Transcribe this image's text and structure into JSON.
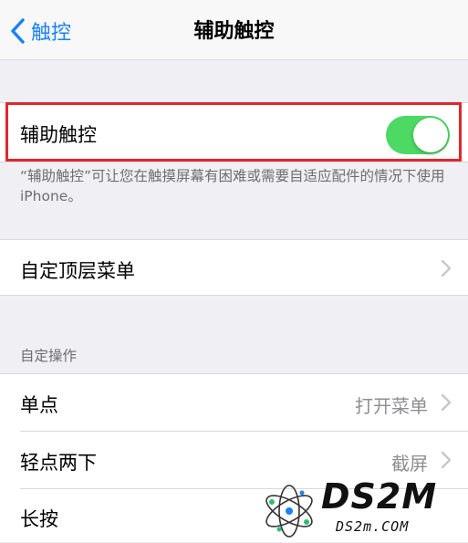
{
  "navbar": {
    "back_label": "触控",
    "title": "辅助触控"
  },
  "assistive_touch": {
    "label": "辅助触控",
    "enabled": true,
    "footnote": "“辅助触控”可让您在触摸屏幕有困难或需要自适应配件的情况下使用iPhone。"
  },
  "customize_menu": {
    "label": "自定顶层菜单"
  },
  "custom_actions": {
    "header": "自定操作",
    "rows": [
      {
        "label": "单点",
        "value": "打开菜单"
      },
      {
        "label": "轻点两下",
        "value": "截屏"
      },
      {
        "label": "长按",
        "value": ""
      }
    ]
  },
  "watermark": {
    "brand": "DS2M",
    "domain": "DS2m.COM"
  },
  "colors": {
    "accent": "#1a82fb",
    "toggle_on": "#4cd964",
    "highlight": "#e0272b"
  }
}
